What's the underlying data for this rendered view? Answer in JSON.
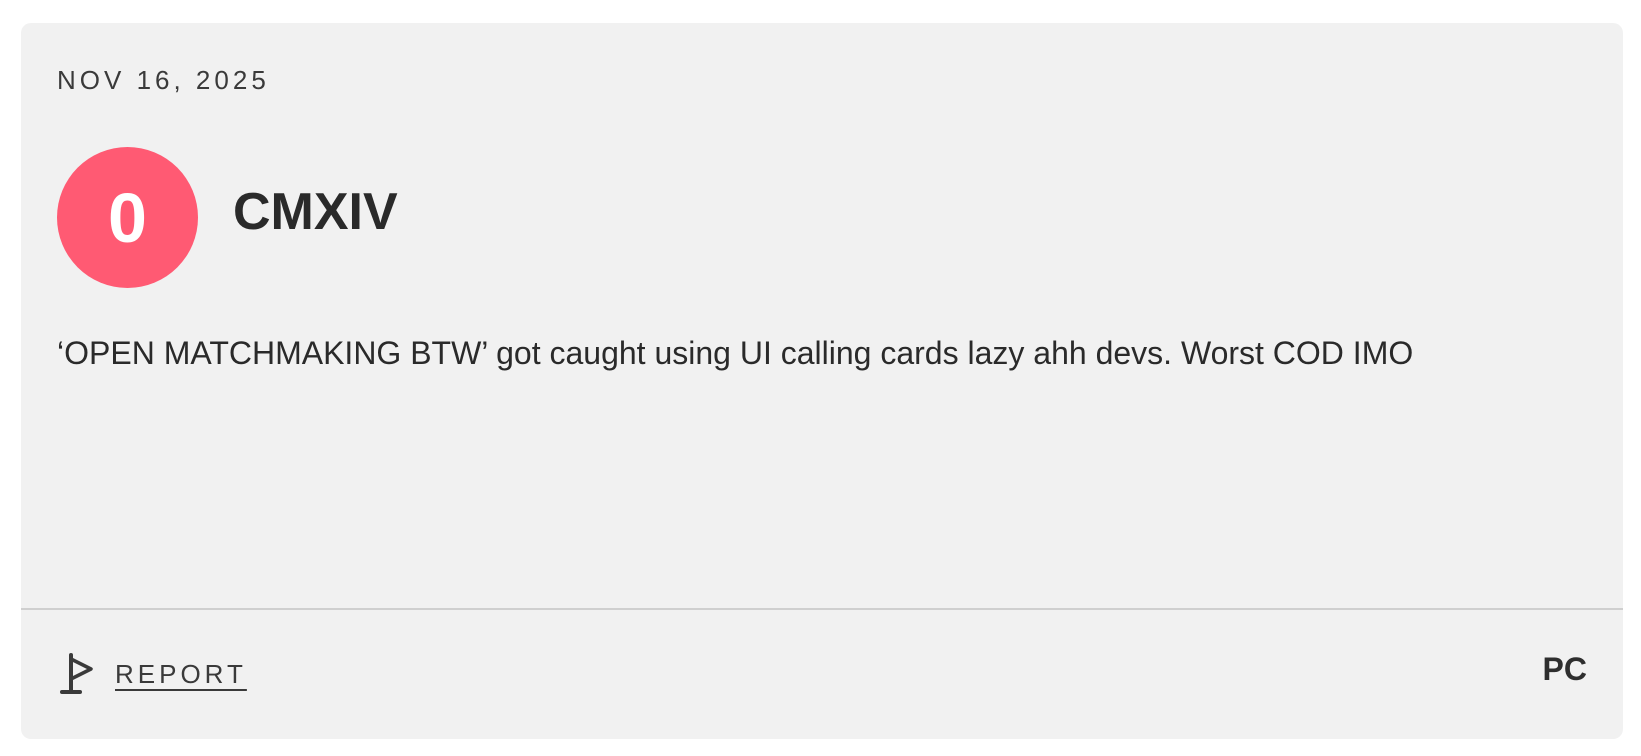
{
  "review": {
    "date": "NOV 16, 2025",
    "score": "0",
    "username": "CMXIV",
    "text": "‘OPEN MATCHMAKING BTW’ got caught using UI calling cards lazy ahh devs. Worst COD IMO",
    "platform": "PC"
  },
  "footer": {
    "report_label": "REPORT",
    "report_icon": "flag-icon"
  },
  "colors": {
    "card_background": "#f1f1f1",
    "score_badge": "#ff5a73",
    "text": "#2a2a2a",
    "divider": "#cfcfcf"
  }
}
